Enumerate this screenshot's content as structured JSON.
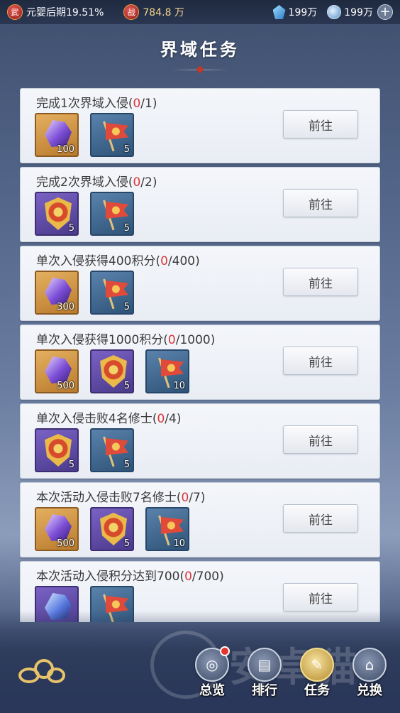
{
  "topbar": {
    "realm_icon_char": "武",
    "realm_text": "元婴后期19.51%",
    "power_icon_char": "战",
    "power_value": "784.8 万",
    "gem_value": "199万",
    "coin_value": "199万",
    "plus_symbol": "+"
  },
  "page_title": "界域任务",
  "tasks": [
    {
      "prefix": "完成1次界域入侵(",
      "current": "0",
      "suffix": "/1)",
      "button": "前往",
      "rewards": [
        {
          "icon": "crystal-icon",
          "qty": "100"
        },
        {
          "icon": "flag-icon",
          "qty": "5"
        }
      ]
    },
    {
      "prefix": "完成2次界域入侵(",
      "current": "0",
      "suffix": "/2)",
      "button": "前往",
      "rewards": [
        {
          "icon": "shield-icon",
          "qty": "5"
        },
        {
          "icon": "flag-icon",
          "qty": "5"
        }
      ]
    },
    {
      "prefix": "单次入侵获得400积分(",
      "current": "0",
      "suffix": "/400)",
      "button": "前往",
      "rewards": [
        {
          "icon": "crystal-icon",
          "qty": "300"
        },
        {
          "icon": "flag-icon",
          "qty": "5"
        }
      ]
    },
    {
      "prefix": "单次入侵获得1000积分(",
      "current": "0",
      "suffix": "/1000)",
      "button": "前往",
      "rewards": [
        {
          "icon": "crystal-icon",
          "qty": "500"
        },
        {
          "icon": "shield-icon",
          "qty": "5"
        },
        {
          "icon": "flag-icon",
          "qty": "10"
        }
      ]
    },
    {
      "prefix": "单次入侵击败4名修士(",
      "current": "0",
      "suffix": "/4)",
      "button": "前往",
      "rewards": [
        {
          "icon": "shield-icon",
          "qty": "5"
        },
        {
          "icon": "flag-icon",
          "qty": "5"
        }
      ]
    },
    {
      "prefix": "本次活动入侵击败7名修士(",
      "current": "0",
      "suffix": "/7)",
      "button": "前往",
      "rewards": [
        {
          "icon": "crystal-icon",
          "qty": "500"
        },
        {
          "icon": "shield-icon",
          "qty": "5"
        },
        {
          "icon": "flag-icon",
          "qty": "10"
        }
      ]
    },
    {
      "prefix": "本次活动入侵积分达到700(",
      "current": "0",
      "suffix": "/700)",
      "button": "前往",
      "rewards": [
        {
          "icon": "blue-crystal-icon",
          "qty": ""
        },
        {
          "icon": "flag-icon",
          "qty": ""
        }
      ]
    }
  ],
  "nav": [
    {
      "label": "总览",
      "icon": "overview-icon",
      "glyph": "◎",
      "active": false,
      "dot": true
    },
    {
      "label": "排行",
      "icon": "ranking-icon",
      "glyph": "▤",
      "active": false,
      "dot": false
    },
    {
      "label": "任务",
      "icon": "task-scroll-icon",
      "glyph": "✎",
      "active": true,
      "dot": false
    },
    {
      "label": "兑换",
      "icon": "exchange-icon",
      "glyph": "⌂",
      "active": false,
      "dot": false
    }
  ],
  "watermark_text": "安卓猫",
  "colors": {
    "progress_current": "#d8383a",
    "gold": "#e7c36a"
  }
}
